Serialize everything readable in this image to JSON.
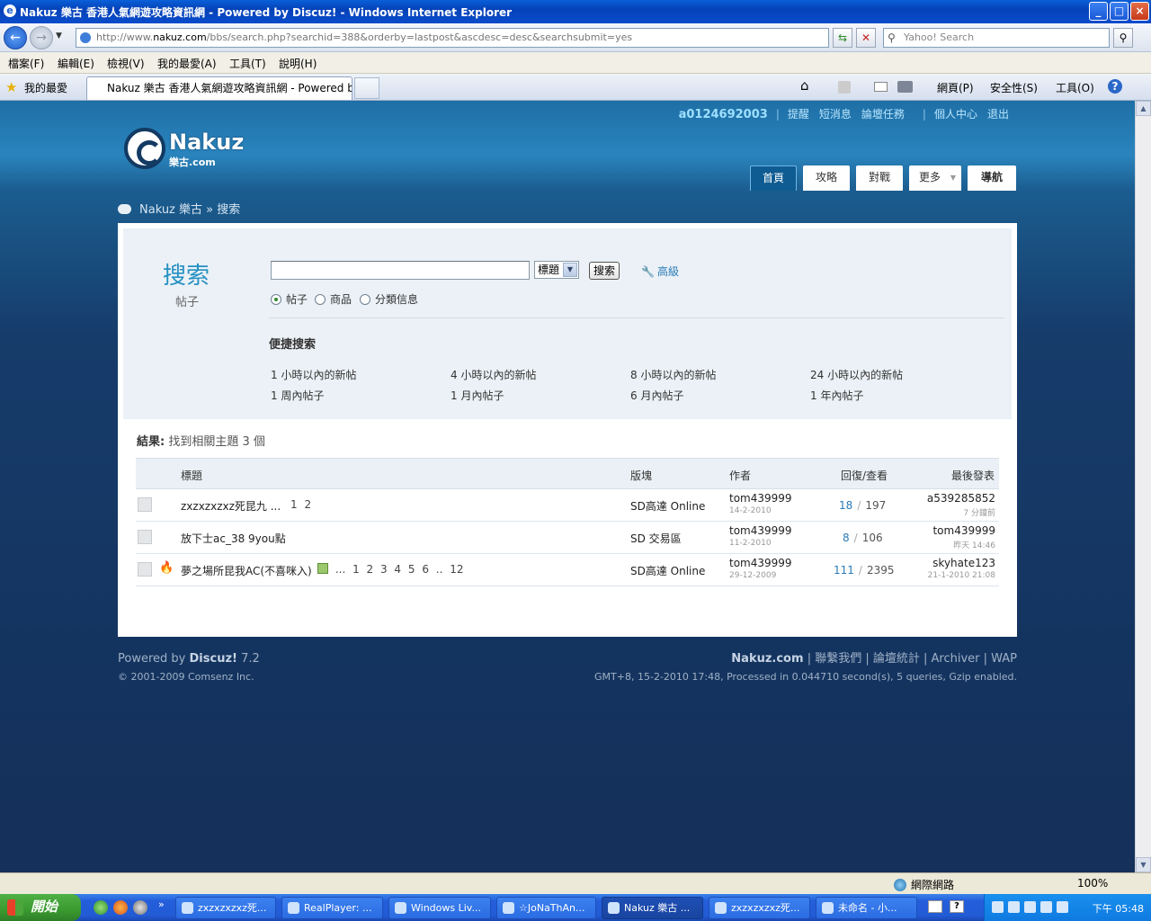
{
  "window": {
    "title": "Nakuz 樂古 香港人氣網遊攻略資訊網 - Powered by Discuz! - Windows Internet Explorer",
    "controls": {
      "minimize": "_",
      "maximize": "□",
      "close": "×"
    }
  },
  "address": {
    "url_prefix": "http://www.",
    "url_domain": "nakuz.com",
    "url_rest": "/bbs/search.php?searchid=388&orderby=lastpost&ascdesc=desc&searchsubmit=yes",
    "search_placeholder": "Yahoo! Search"
  },
  "menu": [
    "檔案(F)",
    "編輯(E)",
    "檢視(V)",
    "我的最愛(A)",
    "工具(T)",
    "說明(H)"
  ],
  "tabs": {
    "favorites_label": "我的最愛",
    "active_tab": "Nakuz 樂古 香港人氣網遊攻略資訊網 - Powered by ..."
  },
  "toolbar_right": {
    "page": "網頁(P)",
    "safety": "安全性(S)",
    "tools": "工具(O)"
  },
  "site": {
    "username": "a0124692003",
    "user_links": [
      "提醒",
      "短消息",
      "論壇任務"
    ],
    "user_links2": [
      "個人中心",
      "退出"
    ],
    "logo_text": "Nakuz",
    "logo_sub": "樂古.com",
    "nav": [
      "首頁",
      "攻略",
      "對戰",
      "更多",
      "導航"
    ],
    "breadcrumb_home": "Nakuz 樂古",
    "breadcrumb_sep": "»",
    "breadcrumb_current": "搜索"
  },
  "search": {
    "title": "搜索",
    "subtitle": "帖子",
    "select_value": "標題",
    "button": "搜索",
    "advanced": "高級",
    "radios": [
      {
        "label": "帖子",
        "checked": true
      },
      {
        "label": "商品",
        "checked": false
      },
      {
        "label": "分類信息",
        "checked": false
      }
    ],
    "quick_heading": "便捷搜索",
    "quick_links": [
      "1 小時以內的新帖",
      "4 小時以內的新帖",
      "8 小時以內的新帖",
      "24 小時以內的新帖",
      "1 周內帖子",
      "1 月內帖子",
      "6 月內帖子",
      "1 年內帖子"
    ]
  },
  "results": {
    "label": "結果:",
    "text": "找到相關主題 3 個",
    "headers": {
      "title": "標題",
      "forum": "版塊",
      "author": "作者",
      "replies_views": "回復/查看",
      "last_post": "最後發表"
    },
    "rows": [
      {
        "subject": "zxzxzxzxz死昆九 ...",
        "pages": "1 2",
        "forum": "SD高達 Online",
        "author": "tom439999",
        "date": "14-2-2010",
        "replies": "18",
        "views": "197",
        "last_user": "a539285852",
        "last_time": "7 分鐘前",
        "hot": false
      },
      {
        "subject": "放下士ac_38 9you點",
        "pages": "",
        "forum": "SD 交易區",
        "author": "tom439999",
        "date": "11-2-2010",
        "replies": "8",
        "views": "106",
        "last_user": "tom439999",
        "last_time": "昨天 14:46",
        "hot": false
      },
      {
        "subject": "夢之場所昆我AC(不喜咪入)",
        "pages": "... 1 2 3 4 5 6 .. 12",
        "forum": "SD高達 Online",
        "author": "tom439999",
        "date": "29-12-2009",
        "replies": "111",
        "views": "2395",
        "last_user": "skyhate123",
        "last_time": "21-1-2010 21:08",
        "hot": true
      }
    ]
  },
  "footer": {
    "powered_prefix": "Powered by",
    "powered_brand": "Discuz!",
    "powered_ver": "7.2",
    "copyright": "© 2001-2009 Comsenz Inc.",
    "site": "Nakuz.com",
    "links": "| 聯繫我們 | 論壇統計 | Archiver | WAP",
    "info": "GMT+8, 15-2-2010 17:48, Processed in 0.044710 second(s), 5 queries, Gzip enabled."
  },
  "statusbar": {
    "zone": "網際網路",
    "zoom": "100%"
  },
  "taskbar": {
    "start": "開始",
    "buttons": [
      "zxzxzxzxz死...",
      "RealPlayer: ...",
      "Windows Liv...",
      "☆JoNaThAn...",
      "Nakuz 樂古 ...",
      "zxzxzxzxz死...",
      "未命名 - 小..."
    ],
    "clock": "下午 05:48"
  }
}
